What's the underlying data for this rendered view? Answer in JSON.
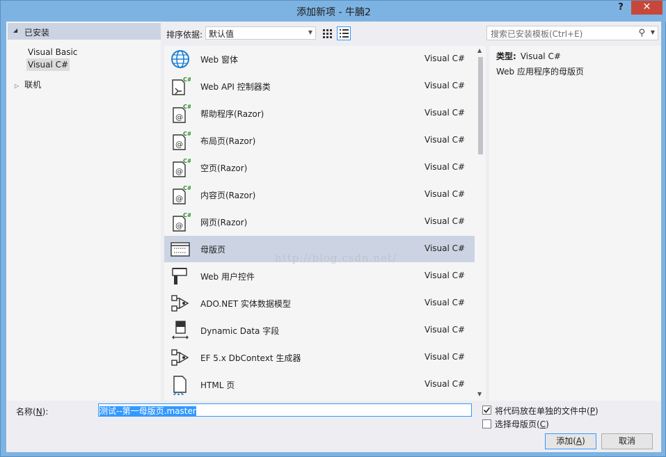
{
  "window": {
    "title": "添加新项 - 牛腩2",
    "help": "?",
    "close": "✕"
  },
  "tree": {
    "header": "已安装",
    "items": [
      "Visual Basic",
      "Visual C#"
    ],
    "online": "联机"
  },
  "toolbar": {
    "sort_label": "排序依据:",
    "sort_value": "默认值",
    "search_placeholder": "搜索已安装模板(Ctrl+E)"
  },
  "items": [
    {
      "name": "Web 窗体",
      "lang": "Visual C#",
      "icon": "globe-icon"
    },
    {
      "name": "Web API 控制器类",
      "lang": "Visual C#",
      "icon": "api-controller-icon"
    },
    {
      "name": "帮助程序(Razor)",
      "lang": "Visual C#",
      "icon": "razor-page-icon"
    },
    {
      "name": "布局页(Razor)",
      "lang": "Visual C#",
      "icon": "razor-page-icon"
    },
    {
      "name": "空页(Razor)",
      "lang": "Visual C#",
      "icon": "razor-page-icon"
    },
    {
      "name": "内容页(Razor)",
      "lang": "Visual C#",
      "icon": "razor-page-icon"
    },
    {
      "name": "网页(Razor)",
      "lang": "Visual C#",
      "icon": "razor-page-icon"
    },
    {
      "name": "母版页",
      "lang": "Visual C#",
      "icon": "master-page-icon"
    },
    {
      "name": "Web 用户控件",
      "lang": "Visual C#",
      "icon": "user-control-icon"
    },
    {
      "name": "ADO.NET 实体数据模型",
      "lang": "Visual C#",
      "icon": "entity-model-icon"
    },
    {
      "name": "Dynamic Data 字段",
      "lang": "Visual C#",
      "icon": "dynamic-data-icon"
    },
    {
      "name": "EF 5.x DbContext 生成器",
      "lang": "Visual C#",
      "icon": "entity-model-icon"
    },
    {
      "name": "HTML 页",
      "lang": "Visual C#",
      "icon": "html-page-icon"
    }
  ],
  "selected_index": 7,
  "description": {
    "type_label": "类型:",
    "type_value": "Visual C#",
    "info": "Web 应用程序的母版页"
  },
  "watermark": "http://blog.csdn.net/",
  "bottom": {
    "name_label_pre": "名称(",
    "name_label_key": "N",
    "name_label_post": "):",
    "name_value": "测试--第一母版页.master",
    "check1_pre": "将代码放在单独的文件中(",
    "check1_key": "P",
    "check1_post": ")",
    "check1_checked": true,
    "check2_pre": "选择母版页(",
    "check2_key": "C",
    "check2_post": ")",
    "check2_checked": false,
    "add_pre": "添加(",
    "add_key": "A",
    "add_post": ")",
    "cancel": "取消"
  }
}
